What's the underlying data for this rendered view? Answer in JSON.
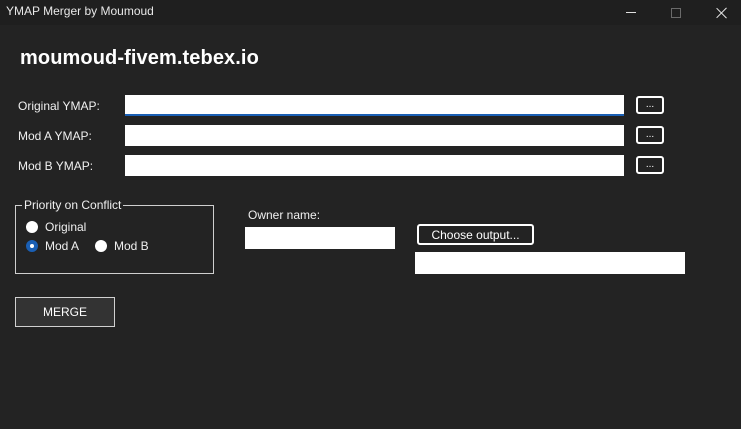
{
  "window": {
    "title": "YMAP Merger by Moumoud"
  },
  "brand": {
    "text": "moumoud-fivem.tebex.io"
  },
  "fields": {
    "original": {
      "label": "Original YMAP:",
      "value": "",
      "browse_label": "..."
    },
    "mod_a": {
      "label": "Mod A YMAP:",
      "value": "",
      "browse_label": "..."
    },
    "mod_b": {
      "label": "Mod B YMAP:",
      "value": "",
      "browse_label": "..."
    }
  },
  "priority": {
    "legend": "Priority on Conflict",
    "options": [
      {
        "label": "Original",
        "checked": false
      },
      {
        "label": "Mod A",
        "checked": true
      },
      {
        "label": "Mod B",
        "checked": false
      }
    ]
  },
  "owner": {
    "label": "Owner name:",
    "value": ""
  },
  "output": {
    "choose_label": "Choose output...",
    "path": ""
  },
  "merge": {
    "label": "MERGE"
  },
  "colors": {
    "background": "#232323",
    "accent": "#1a5fb4",
    "text": "#ffffff"
  }
}
